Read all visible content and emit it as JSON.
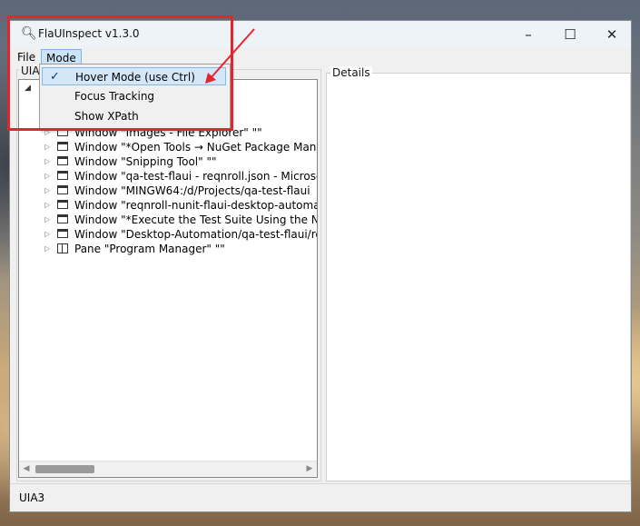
{
  "window": {
    "title": "FlaUInspect v1.3.0",
    "title_icon": "magnifier-icon",
    "controls": {
      "minimize": "–",
      "maximize": "☐",
      "close": "✕"
    }
  },
  "menu": {
    "file": "File",
    "mode": "Mode"
  },
  "mode_menu": {
    "items": [
      {
        "label": "Hover Mode (use Ctrl)",
        "checked": true,
        "check_glyph": "✓"
      },
      {
        "label": "Focus Tracking",
        "checked": false
      },
      {
        "label": "Show XPath",
        "checked": false
      }
    ]
  },
  "tree": {
    "group_label": "UIA3",
    "root_expander": "◢",
    "rows": [
      {
        "label": "Window \"Images - File Explorer\" \"\"",
        "icon": "window-icon",
        "expander": "▷"
      },
      {
        "label": "Window \"*Open Tools → NuGet Package Manager",
        "icon": "window-icon",
        "expander": "▷"
      },
      {
        "label": "Window \"Snipping Tool\" \"\"",
        "icon": "window-icon",
        "expander": "▷"
      },
      {
        "label": "Window \"qa-test-flaui - reqnroll.json - Microsoft V",
        "icon": "window-icon",
        "expander": "▷"
      },
      {
        "label": "Window \"MINGW64:/d/Projects/qa-test-flaui",
        "icon": "window-icon",
        "expander": "▷"
      },
      {
        "label": "Window \"reqnroll-nunit-flaui-desktop-automation",
        "icon": "window-icon",
        "expander": "▷"
      },
      {
        "label": "Window \"*Execute the Test Suite Using the NU - N",
        "icon": "window-icon",
        "expander": "▷"
      },
      {
        "label": "Window \"Desktop-Automation/qa-test-flaui/readr",
        "icon": "window-icon",
        "expander": "▷"
      },
      {
        "label": "Pane \"Program Manager\" \"\"",
        "icon": "pane-icon",
        "expander": "▷"
      }
    ],
    "scroll_left": "◀",
    "scroll_right": "▶"
  },
  "details": {
    "label": "Details"
  },
  "status": {
    "text": "UIA3"
  },
  "colors": {
    "highlight": "#e3262e",
    "menu_active": "#cce4f7",
    "selected_item": "#d3e7f8"
  }
}
